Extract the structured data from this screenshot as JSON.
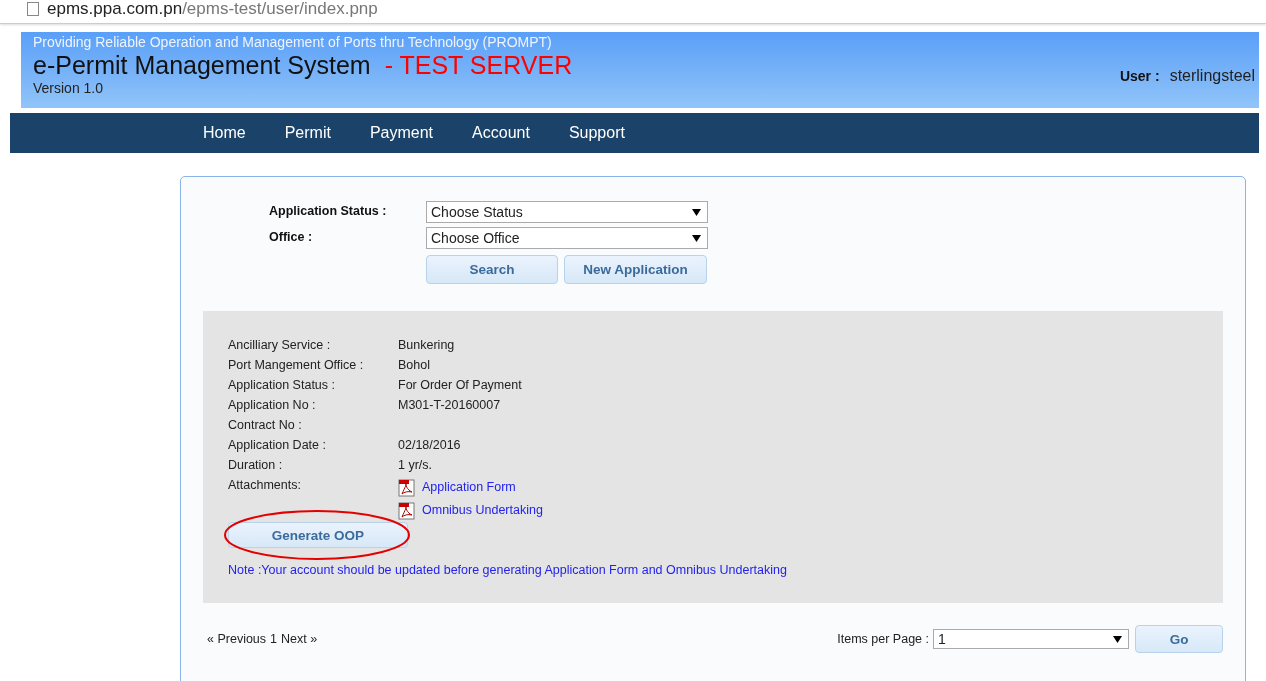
{
  "address_bar": {
    "host": "epms.ppa.com.pn",
    "path": "/epms-test/user/index.pnp"
  },
  "header": {
    "tagline": "Providing Reliable Operation and Management of Ports thru Technology (PROMPT)",
    "title": "e-Permit Management System",
    "server_tag": "- TEST SERVER",
    "version": "Version 1.0",
    "user_label": "User :",
    "user_name": "sterlingsteel"
  },
  "nav": [
    "Home",
    "Permit",
    "Payment",
    "Account",
    "Support"
  ],
  "filters": [
    {
      "label": "Application Status :",
      "value": "Choose Status"
    },
    {
      "label": "Office :",
      "value": "Choose Office"
    }
  ],
  "filter_buttons": [
    "Search",
    "New Application"
  ],
  "details": [
    {
      "label": "Ancilliary Service :",
      "value": "Bunkering"
    },
    {
      "label": "Port Mangement Office :",
      "value": "Bohol"
    },
    {
      "label": "Application Status :",
      "value": "For Order Of Payment"
    },
    {
      "label": "Application No :",
      "value": "M301-T-20160007"
    },
    {
      "label": "Contract No :"
    },
    {
      "label": "Application Date :",
      "value": "02/18/2016"
    },
    {
      "label": "Duration :",
      "value": "1 yr/s."
    }
  ],
  "attachments": {
    "label": "Attachments:",
    "files": [
      "Application Form",
      "Omnibus Undertaking"
    ]
  },
  "action_button": "Generate OOP",
  "note": "Note :Your account should be updated before generating Application Form and Omnibus Undertaking",
  "pagination": {
    "previous": "« Previous",
    "page": "1",
    "next": "Next »"
  },
  "items_per_page": {
    "label": "Items per Page :",
    "value": "1",
    "button": "Go"
  }
}
